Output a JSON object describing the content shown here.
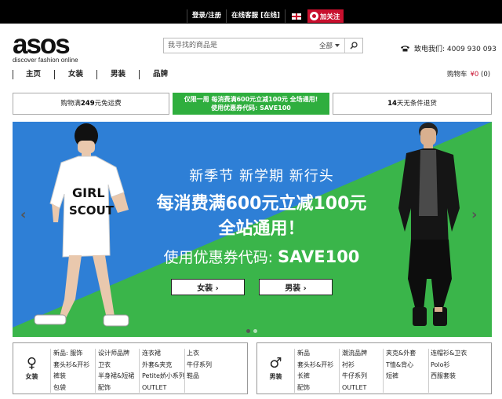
{
  "topbar": {
    "login": "登录/注册",
    "service": "在线客服 [在线]",
    "follow": "加关注"
  },
  "header": {
    "logo": "asos",
    "tagline": "discover fashion online",
    "search_placeholder": "我寻找的商品是",
    "search_scope": "全部",
    "phone": "致电我们: 4009 930 093"
  },
  "nav": {
    "items": [
      "主页",
      "女装",
      "男装",
      "品牌"
    ],
    "cart_label": "购物车",
    "cart_amount": "¥0",
    "cart_count": "(0)"
  },
  "promos": {
    "p1_text": "购物满",
    "p1_amount": "249",
    "p1_suffix": "元免运费",
    "p2_line1": "仅限一周 每消费满600元立减100元 全场通用!",
    "p2_line2": "使用优惠券代码: SAVE100",
    "p3_amount": "14",
    "p3_suffix": "天无条件退货"
  },
  "hero": {
    "line1": "新季节 新学期 新行头",
    "line2": "每消费满600元立减100元",
    "line3": "全站通用！",
    "line4_prefix": "使用优惠券代码: ",
    "code": "SAVE100",
    "btn_women": "女装 ›",
    "btn_men": "男装 ›",
    "arrow_left": "‹",
    "arrow_right": "›",
    "shirt_text": "GIRL SCOUT",
    "colors": {
      "blue": "#2e7fd6",
      "green": "#3ab54a"
    }
  },
  "women": {
    "symbol": "♀",
    "label": "女装",
    "columns": [
      [
        "新品: 服饰",
        "套头衫&开衫",
        "裤装",
        "包袋"
      ],
      [
        "设计师品牌",
        "卫衣",
        "半身裙&短裙",
        "配饰"
      ],
      [
        "连衣裙",
        "外套&夹克",
        "Petite娇小系列",
        "OUTLET"
      ],
      [
        "上衣",
        "牛仔系列",
        "鞋品"
      ]
    ]
  },
  "men": {
    "symbol": "♂",
    "label": "男装",
    "columns": [
      [
        "新品",
        "套头衫&开衫",
        "长裤",
        "配饰"
      ],
      [
        "潮流品牌",
        "衬衫",
        "牛仔系列",
        "OUTLET"
      ],
      [
        "夹克&外套",
        "T恤&背心",
        "短裤"
      ],
      [
        "连帽衫&卫衣",
        "Polo衫",
        "西服套装"
      ]
    ]
  }
}
